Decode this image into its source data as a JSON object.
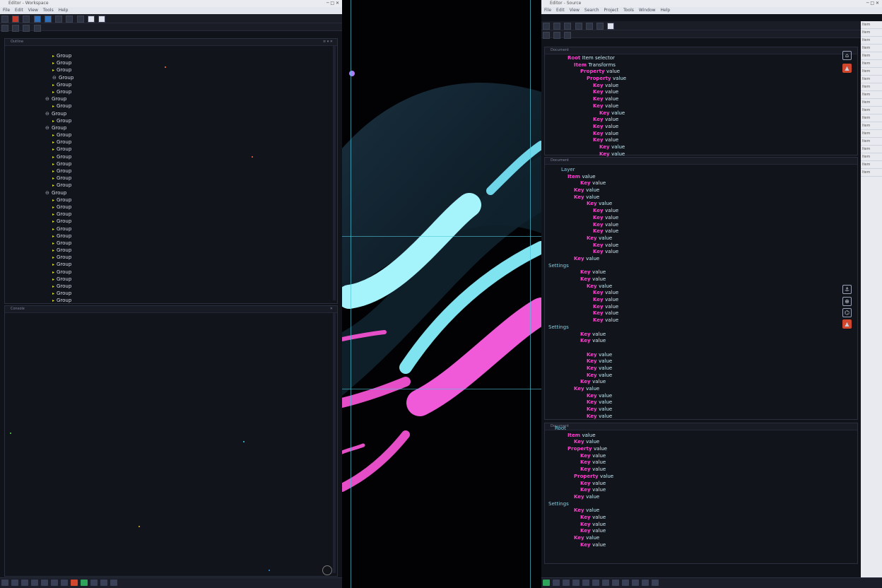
{
  "left_window": {
    "title": "Editor - Workspace",
    "menus": [
      "File",
      "Edit",
      "View",
      "Tools",
      "Help"
    ],
    "tree_panel_title": "Outline",
    "tree_items": [
      {
        "label": "Group",
        "indent": 1,
        "expand": true
      },
      {
        "label": "Group",
        "indent": 1,
        "expand": true
      },
      {
        "label": "Group",
        "indent": 1,
        "expand": true
      },
      {
        "label": "Group",
        "indent": 1,
        "expand": false
      },
      {
        "label": "Group",
        "indent": 1,
        "expand": true
      },
      {
        "label": "Group",
        "indent": 1,
        "expand": true
      },
      {
        "label": "Group",
        "indent": 0,
        "expand": false
      },
      {
        "label": "Group",
        "indent": 1,
        "expand": true
      },
      {
        "label": "Group",
        "indent": 0,
        "expand": false
      },
      {
        "label": "Group",
        "indent": 1,
        "expand": true
      },
      {
        "label": "Group",
        "indent": 0,
        "expand": false
      },
      {
        "label": "Group",
        "indent": 1,
        "expand": true
      },
      {
        "label": "Group",
        "indent": 1,
        "expand": true
      },
      {
        "label": "Group",
        "indent": 1,
        "expand": true
      },
      {
        "label": "Group",
        "indent": 1,
        "expand": true
      },
      {
        "label": "Group",
        "indent": 1,
        "expand": true
      },
      {
        "label": "Group",
        "indent": 1,
        "expand": true
      },
      {
        "label": "Group",
        "indent": 1,
        "expand": true
      },
      {
        "label": "Group",
        "indent": 1,
        "expand": true
      },
      {
        "label": "Group",
        "indent": 0,
        "expand": false
      },
      {
        "label": "Group",
        "indent": 1,
        "expand": true
      },
      {
        "label": "Group",
        "indent": 1,
        "expand": true
      },
      {
        "label": "Group",
        "indent": 1,
        "expand": true
      },
      {
        "label": "Group",
        "indent": 1,
        "expand": true
      },
      {
        "label": "Group",
        "indent": 1,
        "expand": true
      },
      {
        "label": "Group",
        "indent": 1,
        "expand": true
      },
      {
        "label": "Group",
        "indent": 1,
        "expand": true
      },
      {
        "label": "Group",
        "indent": 1,
        "expand": true
      },
      {
        "label": "Group",
        "indent": 1,
        "expand": true
      },
      {
        "label": "Group",
        "indent": 1,
        "expand": true
      },
      {
        "label": "Group",
        "indent": 1,
        "expand": true
      },
      {
        "label": "Group",
        "indent": 1,
        "expand": true
      },
      {
        "label": "Group",
        "indent": 1,
        "expand": true
      },
      {
        "label": "Group",
        "indent": 1,
        "expand": true
      },
      {
        "label": "Group",
        "indent": 1,
        "expand": true
      },
      {
        "label": "Group",
        "indent": 1,
        "expand": true
      }
    ],
    "bottom_panel_title": "Console"
  },
  "right_window": {
    "title": "Editor - Source",
    "menus": [
      "File",
      "Edit",
      "View",
      "Search",
      "Project",
      "Tools",
      "Window",
      "Help"
    ],
    "pane1_title": "Document",
    "pane2_title": "Document",
    "pane3_title": "Document",
    "sidebar_items": [
      "Item",
      "Item",
      "Item",
      "Item",
      "Item",
      "Item",
      "Item",
      "Item",
      "Item",
      "Item",
      "Item",
      "Item",
      "Item",
      "Item",
      "Item",
      "Item",
      "Item",
      "Item",
      "Item",
      "Item"
    ],
    "pane1_lines": [
      {
        "kw": "Root",
        "tx": "Item selector",
        "i": 3
      },
      {
        "kw": "Item",
        "tx": "Transforms",
        "i": 4
      },
      {
        "kw": "Property",
        "tx": "value",
        "i": 5
      },
      {
        "kw": "Property",
        "tx": "value",
        "i": 6
      },
      {
        "kw": "Key",
        "tx": "value",
        "i": 7
      },
      {
        "kw": "Key",
        "tx": "value",
        "i": 7
      },
      {
        "kw": "Key",
        "tx": "value",
        "i": 7
      },
      {
        "kw": "Key",
        "tx": "value",
        "i": 7
      },
      {
        "kw": "Key",
        "tx": "value",
        "i": 8
      },
      {
        "kw": "Key",
        "tx": "value",
        "i": 7
      },
      {
        "kw": "Key",
        "tx": "value",
        "i": 7
      },
      {
        "kw": "Key",
        "tx": "value",
        "i": 7
      },
      {
        "kw": "Key",
        "tx": "value",
        "i": 7
      },
      {
        "kw": "Key",
        "tx": "value",
        "i": 8
      },
      {
        "kw": "Key",
        "tx": "value",
        "i": 8
      }
    ],
    "pane2_lines": [
      {
        "kw": "",
        "tx": "Layer",
        "i": 2
      },
      {
        "kw": "Item",
        "tx": "value",
        "i": 3
      },
      {
        "kw": "Key",
        "tx": "value",
        "i": 5
      },
      {
        "kw": "Key",
        "tx": "value",
        "i": 4
      },
      {
        "kw": "Key",
        "tx": "value",
        "i": 4
      },
      {
        "kw": "Key",
        "tx": "value",
        "i": 6
      },
      {
        "kw": "Key",
        "tx": "value",
        "i": 7
      },
      {
        "kw": "Key",
        "tx": "value",
        "i": 7
      },
      {
        "kw": "Key",
        "tx": "value",
        "i": 7
      },
      {
        "kw": "Key",
        "tx": "value",
        "i": 7
      },
      {
        "kw": "Key",
        "tx": "value",
        "i": 6
      },
      {
        "kw": "Key",
        "tx": "value",
        "i": 7
      },
      {
        "kw": "Key",
        "tx": "value",
        "i": 7
      },
      {
        "kw": "Key",
        "tx": "value",
        "i": 4
      },
      {
        "kw": "",
        "tx": "Settings",
        "i": 0
      },
      {
        "kw": "Key",
        "tx": "value",
        "i": 5
      },
      {
        "kw": "Key",
        "tx": "value",
        "i": 5
      },
      {
        "kw": "Key",
        "tx": "value",
        "i": 6
      },
      {
        "kw": "Key",
        "tx": "value",
        "i": 7
      },
      {
        "kw": "Key",
        "tx": "value",
        "i": 7
      },
      {
        "kw": "Key",
        "tx": "value",
        "i": 7
      },
      {
        "kw": "Key",
        "tx": "value",
        "i": 7
      },
      {
        "kw": "Key",
        "tx": "value",
        "i": 7
      },
      {
        "kw": "",
        "tx": "Settings",
        "i": 0
      },
      {
        "kw": "Key",
        "tx": "value",
        "i": 5
      },
      {
        "kw": "Key",
        "tx": "value",
        "i": 5
      },
      {
        "kw": "",
        "tx": "",
        "i": 0
      },
      {
        "kw": "Key",
        "tx": "value",
        "i": 6
      },
      {
        "kw": "Key",
        "tx": "value",
        "i": 6
      },
      {
        "kw": "Key",
        "tx": "value",
        "i": 6
      },
      {
        "kw": "Key",
        "tx": "value",
        "i": 6
      },
      {
        "kw": "Key",
        "tx": "value",
        "i": 5
      },
      {
        "kw": "Key",
        "tx": "value",
        "i": 4
      },
      {
        "kw": "Key",
        "tx": "value",
        "i": 6
      },
      {
        "kw": "Key",
        "tx": "value",
        "i": 6
      },
      {
        "kw": "Key",
        "tx": "value",
        "i": 6
      },
      {
        "kw": "Key",
        "tx": "value",
        "i": 6
      }
    ],
    "pane3_lines": [
      {
        "kw": "",
        "tx": "Root",
        "i": 1
      },
      {
        "kw": "Item",
        "tx": "value",
        "i": 3
      },
      {
        "kw": "Key",
        "tx": "value",
        "i": 4
      },
      {
        "kw": "Property",
        "tx": "value",
        "i": 3
      },
      {
        "kw": "Key",
        "tx": "value",
        "i": 5
      },
      {
        "kw": "Key",
        "tx": "value",
        "i": 5
      },
      {
        "kw": "Key",
        "tx": "value",
        "i": 5
      },
      {
        "kw": "Property",
        "tx": "value",
        "i": 4
      },
      {
        "kw": "Key",
        "tx": "value",
        "i": 5
      },
      {
        "kw": "Key",
        "tx": "value",
        "i": 5
      },
      {
        "kw": "Key",
        "tx": "value",
        "i": 4
      },
      {
        "kw": "",
        "tx": "Settings",
        "i": 0
      },
      {
        "kw": "Key",
        "tx": "value",
        "i": 4
      },
      {
        "kw": "Key",
        "tx": "value",
        "i": 5
      },
      {
        "kw": "Key",
        "tx": "value",
        "i": 5
      },
      {
        "kw": "Key",
        "tx": "value",
        "i": 5
      },
      {
        "kw": "Key",
        "tx": "value",
        "i": 4
      },
      {
        "kw": "Key",
        "tx": "value",
        "i": 5
      }
    ]
  },
  "taskbar_items": [
    "app",
    "app",
    "app",
    "app",
    "app",
    "app",
    "app",
    "app",
    "app",
    "app",
    "app",
    "app"
  ]
}
